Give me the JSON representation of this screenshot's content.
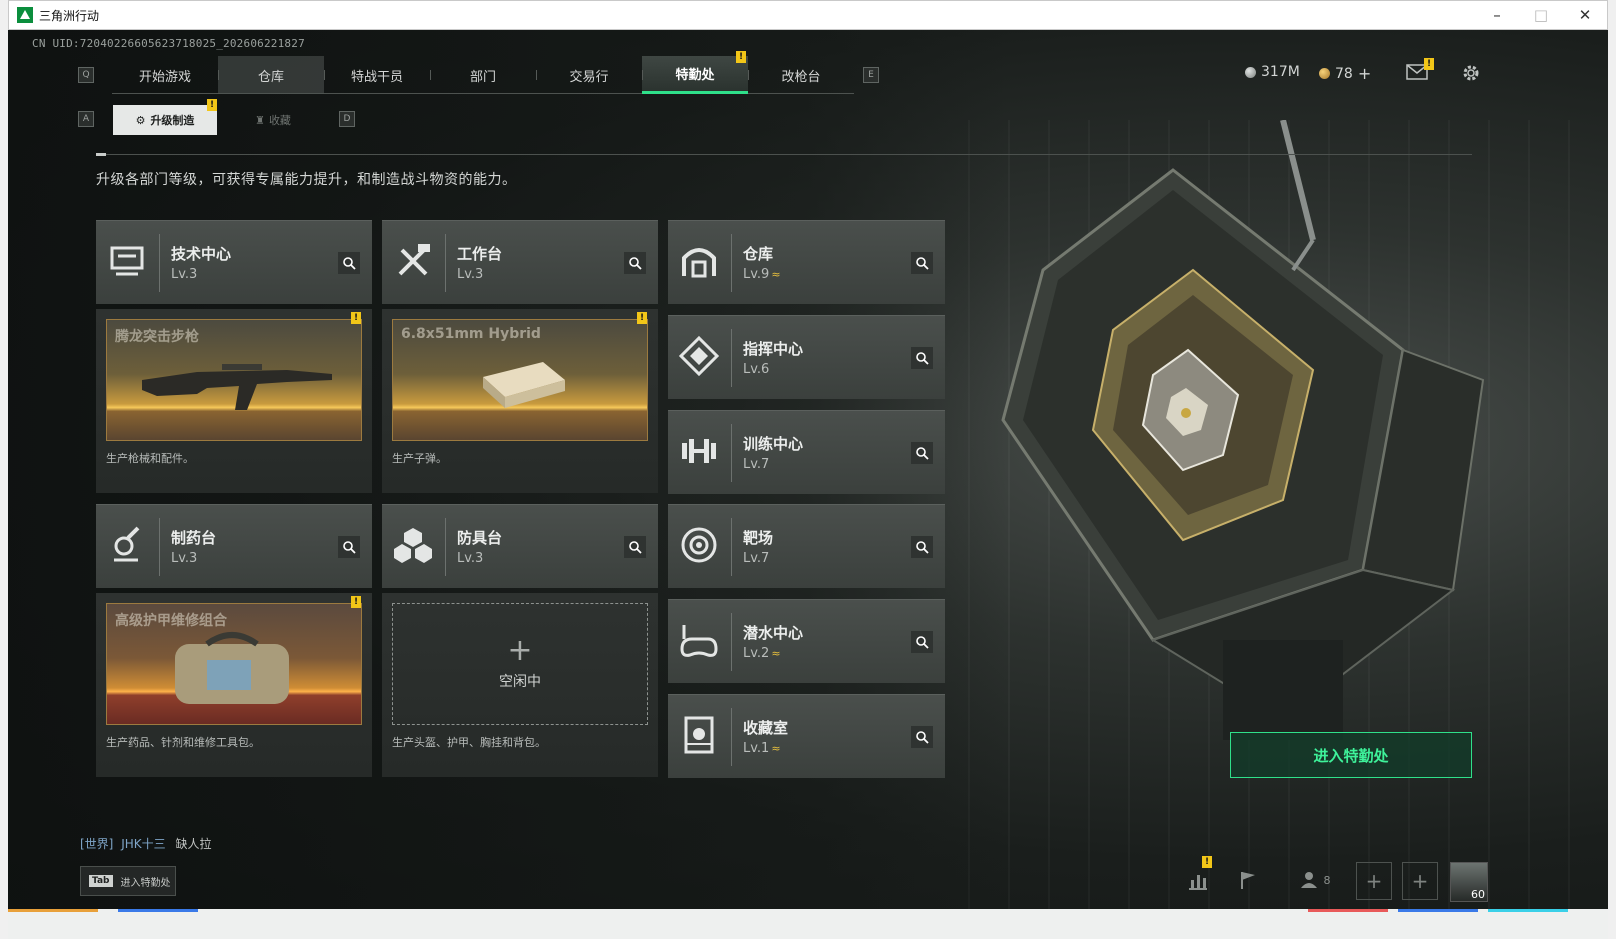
{
  "window": {
    "title": "三角洲行动",
    "controls": [
      "–",
      "□",
      "✕"
    ]
  },
  "uid": "CN UID:720402266056237180​25_202606221827",
  "key_hints": {
    "left_nav": "Q",
    "right_nav": "E",
    "left_sub": "A",
    "right_sub": "D"
  },
  "nav": {
    "tabs": [
      {
        "label": "开始游戏"
      },
      {
        "label": "仓库"
      },
      {
        "label": "特战干员"
      },
      {
        "label": "部门"
      },
      {
        "label": "交易行"
      },
      {
        "label": "特勤处",
        "badge": "!"
      },
      {
        "label": "改枪台"
      }
    ],
    "active_tab": "特勤处"
  },
  "currency": {
    "silver": "317M",
    "gold": "78",
    "add": "+"
  },
  "subtabs": {
    "active": "升级制造",
    "active_badge": "!",
    "inactive": "收藏"
  },
  "intro": "升级各部门等级，可获得专属能力提升，和制造战斗物资的能力。",
  "departments": [
    {
      "name": "技术中心",
      "level": "Lv.3",
      "icon": "monitor-icon"
    },
    {
      "name": "工作台",
      "level": "Lv.3",
      "icon": "tools-icon"
    },
    {
      "name": "仓库",
      "level": "Lv.9",
      "upgrade": "≈",
      "icon": "vault-icon"
    },
    {
      "name": "指挥中心",
      "level": "Lv.6",
      "icon": "command-icon"
    },
    {
      "name": "训练中心",
      "level": "Lv.7",
      "icon": "dumbbell-icon"
    },
    {
      "name": "制药台",
      "level": "Lv.3",
      "icon": "microscope-icon"
    },
    {
      "name": "防具台",
      "level": "Lv.3",
      "icon": "armor-icon"
    },
    {
      "name": "靶场",
      "level": "Lv.7",
      "icon": "target-icon"
    },
    {
      "name": "潜水中心",
      "level": "Lv.2",
      "upgrade": "≈",
      "icon": "goggles-icon"
    },
    {
      "name": "收藏室",
      "level": "Lv.1",
      "upgrade": "≈",
      "icon": "collection-icon"
    }
  ],
  "production": [
    {
      "title": "腾龙突击步枪",
      "desc": "生产枪械和配件。",
      "badge": "!"
    },
    {
      "title": "6.8x51mm Hybrid",
      "desc": "生产子弹。",
      "badge": "!"
    },
    {
      "title": "高级护甲维修组合",
      "desc": "生产药品、针剂和维修工具包。",
      "badge": "!"
    },
    {
      "title": "",
      "idle": "空闲中",
      "desc": "生产头盔、护甲、胸挂和背包。"
    }
  ],
  "enter_button": "进入特勤处",
  "chat": {
    "channel": "[世界]",
    "user": "JHK十三",
    "message": "缺人拉"
  },
  "tab_hint": {
    "key": "Tab",
    "label": "进入特勤处"
  },
  "bottom_bar": {
    "friends_count": "8",
    "badge": "!",
    "player_level": "60"
  },
  "colors": {
    "accent": "#2fe08a",
    "badge": "#f2c618",
    "upgrade": "#e9c13e"
  }
}
